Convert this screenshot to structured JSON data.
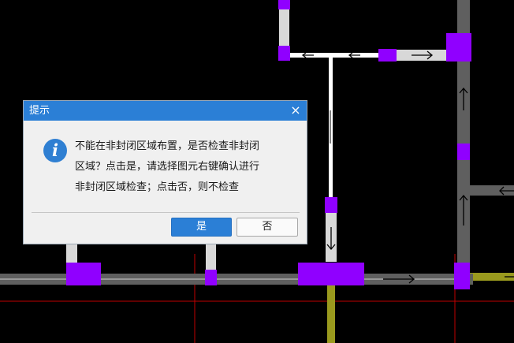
{
  "dialog": {
    "title": "提示",
    "close_glyph": "×",
    "icon": "info-icon",
    "icon_glyph": "i",
    "message_lines": [
      "不能在非封闭区域布置，是否检查非封闭",
      "区域？点击是，请选择图元右键确认进行",
      "非封闭区域检查；点击否，则不检查"
    ],
    "yes_label": "是",
    "no_label": "否"
  },
  "canvas": {
    "background": "#000000",
    "colors": {
      "wall": "#d8d8d8",
      "wall_dark": "#5f5f5f",
      "node": "#9000ff",
      "axis_red": "#c00000",
      "olive": "#9a9a1e",
      "white_line": "#ffffff"
    },
    "arrow_glyph": "→"
  }
}
